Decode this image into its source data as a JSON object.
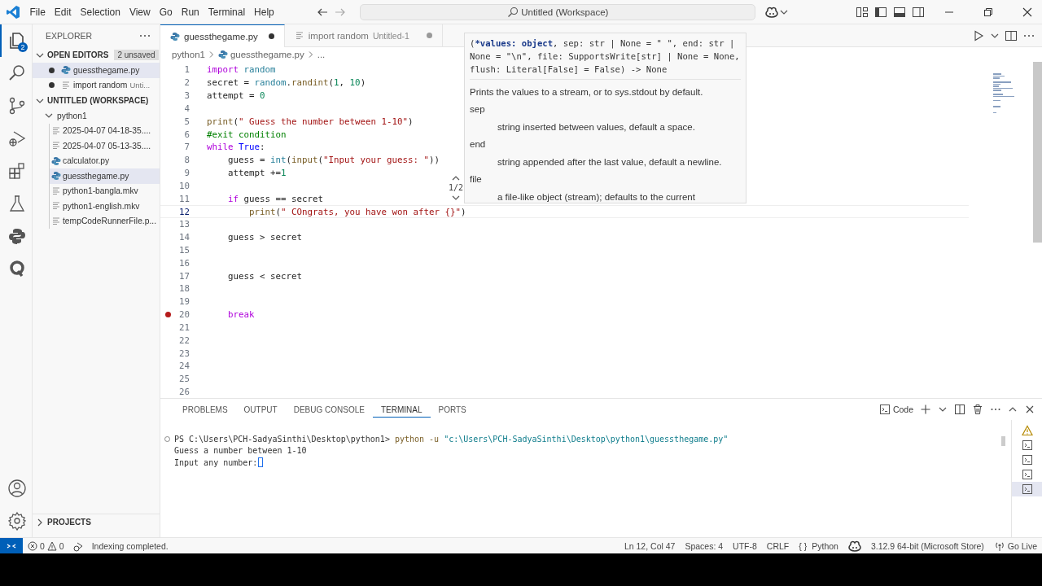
{
  "title_bar": {
    "menus": [
      "File",
      "Edit",
      "Selection",
      "View",
      "Go",
      "Run",
      "Terminal",
      "Help"
    ],
    "command_center": "Untitled (Workspace)"
  },
  "activity_bar": {
    "items": [
      {
        "kind": "explorer",
        "selected": true,
        "badge": "2"
      },
      {
        "kind": "search",
        "selected": false
      },
      {
        "kind": "source-control",
        "selected": false
      },
      {
        "kind": "run-debug",
        "selected": false
      },
      {
        "kind": "extensions",
        "selected": false
      },
      {
        "kind": "testing",
        "selected": false
      },
      {
        "kind": "python",
        "selected": false
      },
      {
        "kind": "extension-q",
        "selected": false
      }
    ],
    "bottom": [
      {
        "kind": "account"
      },
      {
        "kind": "settings"
      }
    ]
  },
  "sidebar": {
    "title": "EXPLORER",
    "open_editors": {
      "label": "OPEN EDITORS",
      "expanded": true,
      "badge": "2 unsaved",
      "items": [
        {
          "name": "guessthegame.py",
          "kind": "python",
          "modified": true,
          "selected": true
        },
        {
          "name": "import random",
          "description": "Unti...",
          "kind": "text",
          "modified": true,
          "selected": false
        }
      ]
    },
    "workspace": {
      "label": "UNTITLED (WORKSPACE)",
      "expanded": true,
      "tree": [
        {
          "name": "python1",
          "expanded": true,
          "children": [
            {
              "name": "2025-04-07 04-18-35....",
              "kind": "text",
              "selected": false
            },
            {
              "name": "2025-04-07 05-13-35....",
              "kind": "text",
              "selected": false
            },
            {
              "name": "calculator.py",
              "kind": "python",
              "selected": false
            },
            {
              "name": "guessthegame.py",
              "kind": "python",
              "selected": true
            },
            {
              "name": "python1-bangla.mkv",
              "kind": "text",
              "selected": false
            },
            {
              "name": "python1-english.mkv",
              "kind": "text",
              "selected": false
            },
            {
              "name": "tempCodeRunnerFile.p...",
              "kind": "text",
              "selected": false
            }
          ]
        }
      ]
    },
    "projects": {
      "label": "PROJECTS",
      "expanded": false
    }
  },
  "editor": {
    "tabs": [
      {
        "label": "guessthegame.py",
        "kind": "python",
        "modified": true,
        "selected": true
      },
      {
        "label": "import random",
        "description": "Untitled-1",
        "kind": "text",
        "modified": true,
        "selected": false
      }
    ],
    "breadcrumbs": [
      {
        "text": "python1",
        "kind": "folder"
      },
      {
        "text": "guessthegame.py",
        "kind": "python"
      },
      {
        "text": "...",
        "kind": "none"
      }
    ],
    "lines": [
      {
        "number": "1",
        "current": false,
        "breakpoint": false,
        "tokens": [
          {
            "text": "import",
            "kind": "keyword"
          },
          {
            "text": " random",
            "kind": "module"
          }
        ]
      },
      {
        "number": "2",
        "current": false,
        "breakpoint": false,
        "tokens": [
          {
            "text": "secret = ",
            "kind": "plain"
          },
          {
            "text": "random",
            "kind": "module"
          },
          {
            "text": ".",
            "kind": "plain"
          },
          {
            "text": "randint",
            "kind": "func"
          },
          {
            "text": "(",
            "kind": "plain"
          },
          {
            "text": "1",
            "kind": "number"
          },
          {
            "text": ", ",
            "kind": "plain"
          },
          {
            "text": "10",
            "kind": "number"
          },
          {
            "text": ")",
            "kind": "plain"
          }
        ]
      },
      {
        "number": "3",
        "current": false,
        "breakpoint": false,
        "tokens": [
          {
            "text": "attempt = ",
            "kind": "plain"
          },
          {
            "text": "0",
            "kind": "number"
          }
        ]
      },
      {
        "number": "4",
        "current": false,
        "breakpoint": false
      },
      {
        "number": "5",
        "current": false,
        "breakpoint": false,
        "tokens": [
          {
            "text": "print",
            "kind": "func"
          },
          {
            "text": "(",
            "kind": "plain"
          },
          {
            "text": "\" Guess the number between 1-10\"",
            "kind": "string"
          },
          {
            "text": ")",
            "kind": "plain"
          }
        ]
      },
      {
        "number": "6",
        "current": false,
        "breakpoint": false,
        "tokens": [
          {
            "text": "#exit condition",
            "kind": "comment"
          }
        ]
      },
      {
        "number": "7",
        "current": false,
        "breakpoint": false,
        "tokens": [
          {
            "text": "while",
            "kind": "keyword"
          },
          {
            "text": " True",
            "kind": "const"
          },
          {
            "text": ":",
            "kind": "plain"
          }
        ]
      },
      {
        "number": "8",
        "current": false,
        "breakpoint": false,
        "tokens": [
          {
            "text": "    guess = ",
            "kind": "plain"
          },
          {
            "text": "int",
            "kind": "module"
          },
          {
            "text": "(",
            "kind": "plain"
          },
          {
            "text": "input",
            "kind": "func"
          },
          {
            "text": "(",
            "kind": "plain"
          },
          {
            "text": "\"Input your guess: \"",
            "kind": "string"
          },
          {
            "text": "))",
            "kind": "plain"
          }
        ]
      },
      {
        "number": "9",
        "current": false,
        "breakpoint": false,
        "tokens": [
          {
            "text": "    attempt +=",
            "kind": "plain"
          },
          {
            "text": "1",
            "kind": "number"
          }
        ]
      },
      {
        "number": "10",
        "current": false,
        "breakpoint": false
      },
      {
        "number": "11",
        "current": false,
        "breakpoint": false,
        "tokens": [
          {
            "text": "    if",
            "kind": "keyword"
          },
          {
            "text": " guess == secret",
            "kind": "plain"
          }
        ]
      },
      {
        "number": "12",
        "current": true,
        "breakpoint": false,
        "tokens": [
          {
            "text": "        print",
            "kind": "func"
          },
          {
            "text": "(",
            "kind": "plain"
          },
          {
            "text": "\" COngrats, you have won after {}\"",
            "kind": "string"
          },
          {
            "text": ")",
            "kind": "plain"
          }
        ]
      },
      {
        "number": "13",
        "current": false,
        "breakpoint": false
      },
      {
        "number": "14",
        "current": false,
        "breakpoint": false,
        "tokens": [
          {
            "text": "    guess > secret",
            "kind": "plain"
          }
        ]
      },
      {
        "number": "15",
        "current": false,
        "breakpoint": false
      },
      {
        "number": "16",
        "current": false,
        "breakpoint": false
      },
      {
        "number": "17",
        "current": false,
        "breakpoint": false,
        "tokens": [
          {
            "text": "    guess < secret",
            "kind": "plain"
          }
        ]
      },
      {
        "number": "18",
        "current": false,
        "breakpoint": false
      },
      {
        "number": "19",
        "current": false,
        "breakpoint": false
      },
      {
        "number": "20",
        "current": false,
        "breakpoint": true,
        "tokens": [
          {
            "text": "    break",
            "kind": "keyword"
          }
        ]
      },
      {
        "number": "21",
        "current": false,
        "breakpoint": false
      },
      {
        "number": "22",
        "current": false,
        "breakpoint": false
      },
      {
        "number": "23",
        "current": false,
        "breakpoint": false
      },
      {
        "number": "24",
        "current": false,
        "breakpoint": false
      },
      {
        "number": "25",
        "current": false,
        "breakpoint": false
      },
      {
        "number": "26",
        "current": false,
        "breakpoint": false
      }
    ]
  },
  "hover": {
    "signature": {
      "prefix": "(",
      "active": "*values: object",
      "rest": ", sep: str | None = \" \", end: str | None = \"\\n\", file: SupportsWrite[str] | None = None, flush: Literal[False] = False) -> None"
    },
    "summary": "Prints the values to a stream, or to sys.stdout by default.",
    "params": [
      {
        "name": "sep",
        "description": "string inserted between values, default a space."
      },
      {
        "name": "end",
        "description": "string appended after the last value, default a newline."
      },
      {
        "name": "file",
        "description": "a file-like object (stream); defaults to the current"
      }
    ],
    "overload": "1/2"
  },
  "panel": {
    "tabs": [
      {
        "label": "PROBLEMS",
        "selected": false
      },
      {
        "label": "OUTPUT",
        "selected": false
      },
      {
        "label": "DEBUG CONSOLE",
        "selected": false
      },
      {
        "label": "TERMINAL",
        "selected": true
      },
      {
        "label": "PORTS",
        "selected": false
      }
    ],
    "terminal_name": "Code",
    "terminal_lines": [
      {
        "prompt_mark": true,
        "cursor": false,
        "tokens": [
          {
            "text": "PS C:\\Users\\PCH-SadyaSinthi\\Desktop\\python1>",
            "kind": "plain"
          },
          {
            "text": " python -u",
            "kind": "command"
          },
          {
            "text": " \"c:\\Users\\PCH-SadyaSinthi\\Desktop\\python1\\guessthegame.py\"",
            "kind": "path"
          }
        ]
      },
      {
        "prompt_mark": false,
        "cursor": false,
        "tokens": [
          {
            "text": "Guess a number between 1-10",
            "kind": "plain"
          }
        ]
      },
      {
        "prompt_mark": false,
        "cursor": true,
        "tokens": [
          {
            "text": "Input any number:",
            "kind": "plain"
          }
        ]
      }
    ],
    "terminals": [
      {
        "kind": "warning",
        "selected": false
      },
      {
        "kind": "terminal",
        "selected": false
      },
      {
        "kind": "terminal",
        "selected": false
      },
      {
        "kind": "terminal",
        "selected": false
      },
      {
        "kind": "terminal",
        "selected": true
      }
    ]
  },
  "status_bar": {
    "errors": "0",
    "warnings": "0",
    "message": "Indexing completed.",
    "items": [
      {
        "kind": "text",
        "text": "Ln 12, Col 47"
      },
      {
        "kind": "text",
        "text": "Spaces: 4"
      },
      {
        "kind": "text",
        "text": "UTF-8"
      },
      {
        "kind": "text",
        "text": "CRLF"
      },
      {
        "kind": "language",
        "text": "Python",
        "glyph": "{ }"
      },
      {
        "kind": "copilot"
      },
      {
        "kind": "text",
        "text": "3.12.9 64-bit (Microsoft Store)"
      },
      {
        "kind": "golive",
        "text": "Go Live"
      }
    ]
  }
}
